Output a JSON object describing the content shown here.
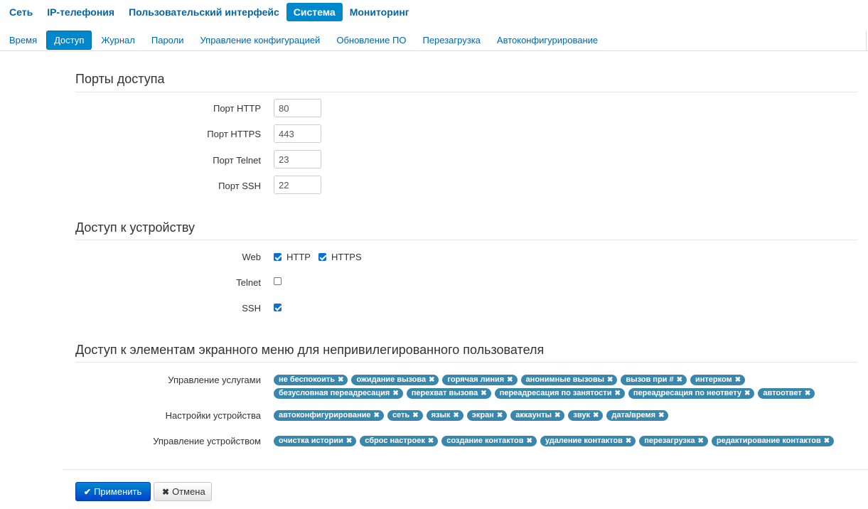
{
  "topnav": [
    {
      "label": "Сеть",
      "active": false
    },
    {
      "label": "IP-телефония",
      "active": false
    },
    {
      "label": "Пользовательский интерфейс",
      "active": false
    },
    {
      "label": "Система",
      "active": true
    },
    {
      "label": "Мониторинг",
      "active": false
    }
  ],
  "subnav": [
    {
      "label": "Время",
      "active": false
    },
    {
      "label": "Доступ",
      "active": true
    },
    {
      "label": "Журнал",
      "active": false
    },
    {
      "label": "Пароли",
      "active": false
    },
    {
      "label": "Управление конфигурацией",
      "active": false
    },
    {
      "label": "Обновление ПО",
      "active": false
    },
    {
      "label": "Перезагрузка",
      "active": false
    },
    {
      "label": "Автоконфигурирование",
      "active": false
    }
  ],
  "ports": {
    "title": "Порты доступа",
    "http_label": "Порт HTTP",
    "http_value": "80",
    "https_label": "Порт HTTPS",
    "https_value": "443",
    "telnet_label": "Порт Telnet",
    "telnet_value": "23",
    "ssh_label": "Порт SSH",
    "ssh_value": "22"
  },
  "device_access": {
    "title": "Доступ к устройству",
    "web_label": "Web",
    "http_label": "HTTP",
    "http_checked": true,
    "https_label": "HTTPS",
    "https_checked": true,
    "telnet_label": "Telnet",
    "telnet_checked": false,
    "ssh_label": "SSH",
    "ssh_checked": true
  },
  "menu_access": {
    "title": "Доступ к элементам экранного меню для непривилегированного пользователя",
    "services_label": "Управление услугами",
    "services": [
      "не беспокоить",
      "ожидание вызова",
      "горячая линия",
      "анонимные вызовы",
      "вызов при #",
      "интерком",
      "безусловная переадресация",
      "перехват вызова",
      "переадресация по занятости",
      "переадресация по неответу",
      "автоответ"
    ],
    "settings_label": "Настройки устройства",
    "settings": [
      "автоконфигурирование",
      "сеть",
      "язык",
      "экран",
      "аккаунты",
      "звук",
      "дата/время"
    ],
    "management_label": "Управление устройством",
    "management": [
      "очистка истории",
      "сброс настроек",
      "создание контактов",
      "удаление контактов",
      "перезагрузка",
      "редактирование контактов"
    ]
  },
  "buttons": {
    "apply_label": "Применить",
    "cancel_label": "Отмена"
  },
  "icons": {
    "apply": "check-icon",
    "cancel": "close-icon",
    "tag_remove": "close-icon"
  }
}
